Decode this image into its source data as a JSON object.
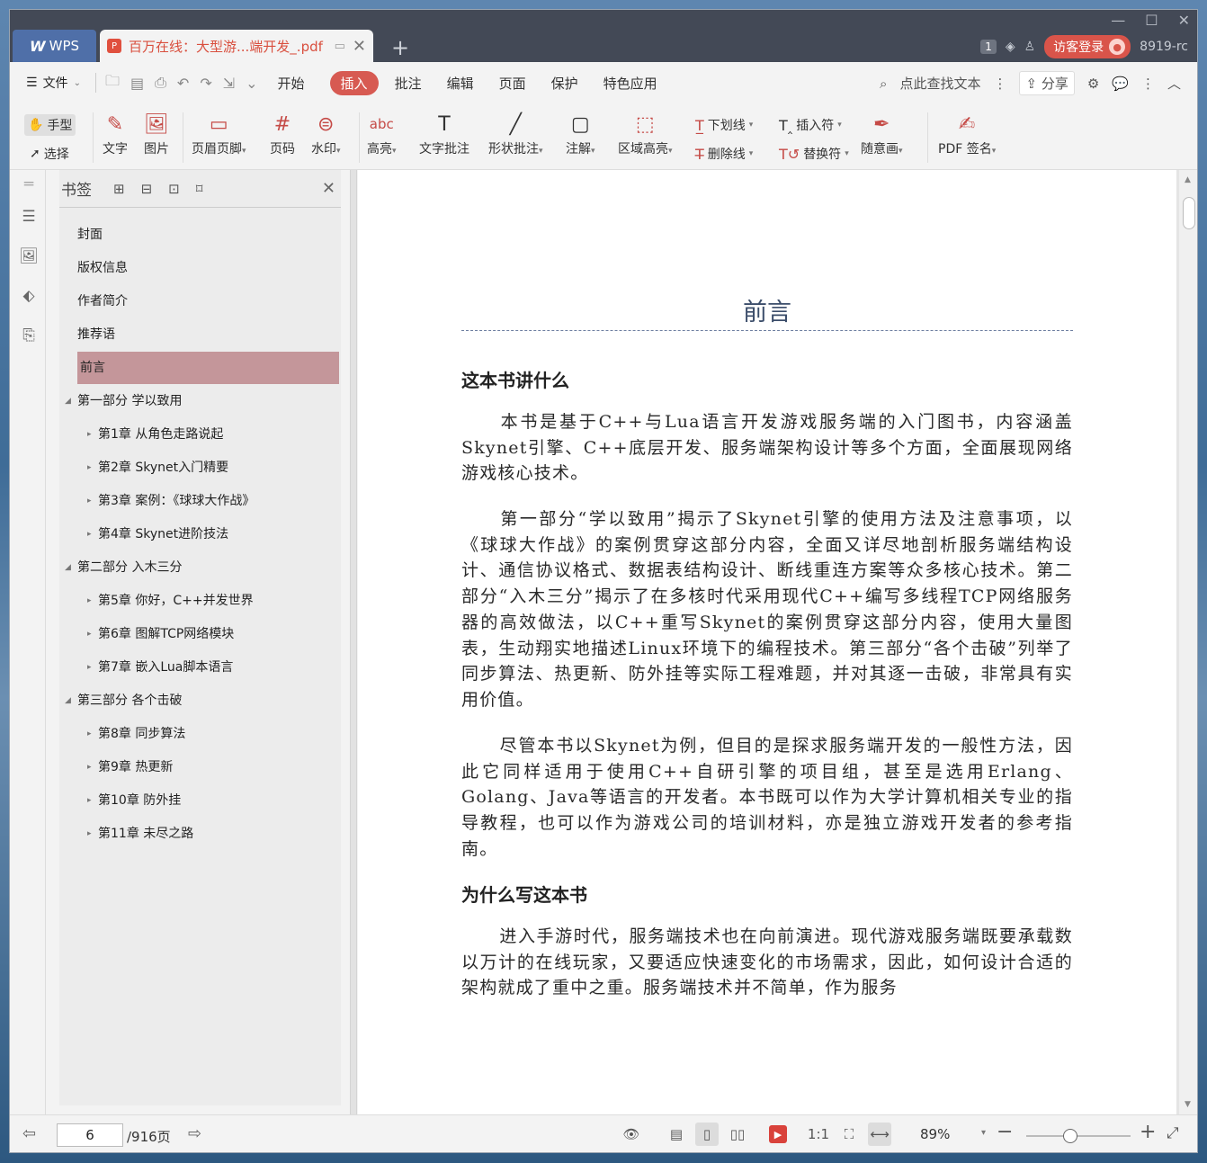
{
  "titlebar": {
    "app_tab": "WPS",
    "doc_tab": "百万在线：大型游...端开发_.pdf",
    "notification_count": "1",
    "login_label": "访客登录",
    "user_code": "8919-rc"
  },
  "menubar": {
    "file_label": "文件",
    "items": [
      "开始",
      "插入",
      "批注",
      "编辑",
      "页面",
      "保护",
      "特色应用"
    ],
    "active_item": "插入",
    "search_label": "点此查找文本",
    "share_label": "分享"
  },
  "ribbon": {
    "hand_label": "手型",
    "select_label": "选择",
    "text_label": "文字",
    "image_label": "图片",
    "header_footer_label": "页眉页脚",
    "page_number_label": "页码",
    "watermark_label": "水印",
    "highlight_label": "高亮",
    "text_comment_label": "文字批注",
    "shape_comment_label": "形状批注",
    "annotation_label": "注解",
    "area_highlight_label": "区域高亮",
    "underline_label": "下划线",
    "strikethrough_label": "删除线",
    "insert_char_label": "插入符",
    "replace_char_label": "替换符",
    "freehand_label": "随意画",
    "pdf_sign_label": "PDF 签名"
  },
  "bookmarks": {
    "title": "书签",
    "items": [
      {
        "label": "封面",
        "level": 0,
        "expandable": false
      },
      {
        "label": "版权信息",
        "level": 0,
        "expandable": false
      },
      {
        "label": "作者简介",
        "level": 0,
        "expandable": false
      },
      {
        "label": "推荐语",
        "level": 0,
        "expandable": false
      },
      {
        "label": "前言",
        "level": 0,
        "expandable": false,
        "selected": true
      },
      {
        "label": "第一部分 学以致用",
        "level": 0,
        "expandable": true
      },
      {
        "label": "第1章 从角色走路说起",
        "level": 1,
        "expandable": true
      },
      {
        "label": "第2章 Skynet入门精要",
        "level": 1,
        "expandable": true
      },
      {
        "label": "第3章 案例：《球球大作战》",
        "level": 1,
        "expandable": true
      },
      {
        "label": "第4章 Skynet进阶技法",
        "level": 1,
        "expandable": true
      },
      {
        "label": "第二部分 入木三分",
        "level": 0,
        "expandable": true
      },
      {
        "label": "第5章 你好，C++并发世界",
        "level": 1,
        "expandable": true
      },
      {
        "label": "第6章 图解TCP网络模块",
        "level": 1,
        "expandable": true
      },
      {
        "label": "第7章 嵌入Lua脚本语言",
        "level": 1,
        "expandable": true
      },
      {
        "label": "第三部分 各个击破",
        "level": 0,
        "expandable": true
      },
      {
        "label": "第8章 同步算法",
        "level": 1,
        "expandable": true
      },
      {
        "label": "第9章 热更新",
        "level": 1,
        "expandable": true
      },
      {
        "label": "第10章 防外挂",
        "level": 1,
        "expandable": true
      },
      {
        "label": "第11章 未尽之路",
        "level": 1,
        "expandable": true
      }
    ]
  },
  "page": {
    "title": "前言",
    "heading1": "这本书讲什么",
    "para1": "本书是基于C++与Lua语言开发游戏服务端的入门图书，内容涵盖Skynet引擎、C++底层开发、服务端架构设计等多个方面，全面展现网络游戏核心技术。",
    "para2": "第一部分“学以致用”揭示了Skynet引擎的使用方法及注意事项，以《球球大作战》的案例贯穿这部分内容，全面又详尽地剖析服务端结构设计、通信协议格式、数据表结构设计、断线重连方案等众多核心技术。第二部分“入木三分”揭示了在多核时代采用现代C++编写多线程TCP网络服务器的高效做法，以C++重写Skynet的案例贯穿这部分内容，使用大量图表，生动翔实地描述Linux环境下的编程技术。第三部分“各个击破”列举了同步算法、热更新、防外挂等实际工程难题，并对其逐一击破，非常具有实用价值。",
    "para3": "尽管本书以Skynet为例，但目的是探求服务端开发的一般性方法，因此它同样适用于使用C++自研引擎的项目组，甚至是选用Erlang、Golang、Java等语言的开发者。本书既可以作为大学计算机相关专业的指导教程，也可以作为游戏公司的培训材料，亦是独立游戏开发者的参考指南。",
    "heading2": "为什么写这本书",
    "para4": "进入手游时代，服务端技术也在向前演进。现代游戏服务端既要承载数以万计的在线玩家，又要适应快速变化的市场需求，因此，如何设计合适的架构就成了重中之重。服务端技术并不简单，作为服务"
  },
  "statusbar": {
    "current_page": "6",
    "total_pages": "/916页",
    "zoom": "89%",
    "zoom_fraction": 0.42
  }
}
